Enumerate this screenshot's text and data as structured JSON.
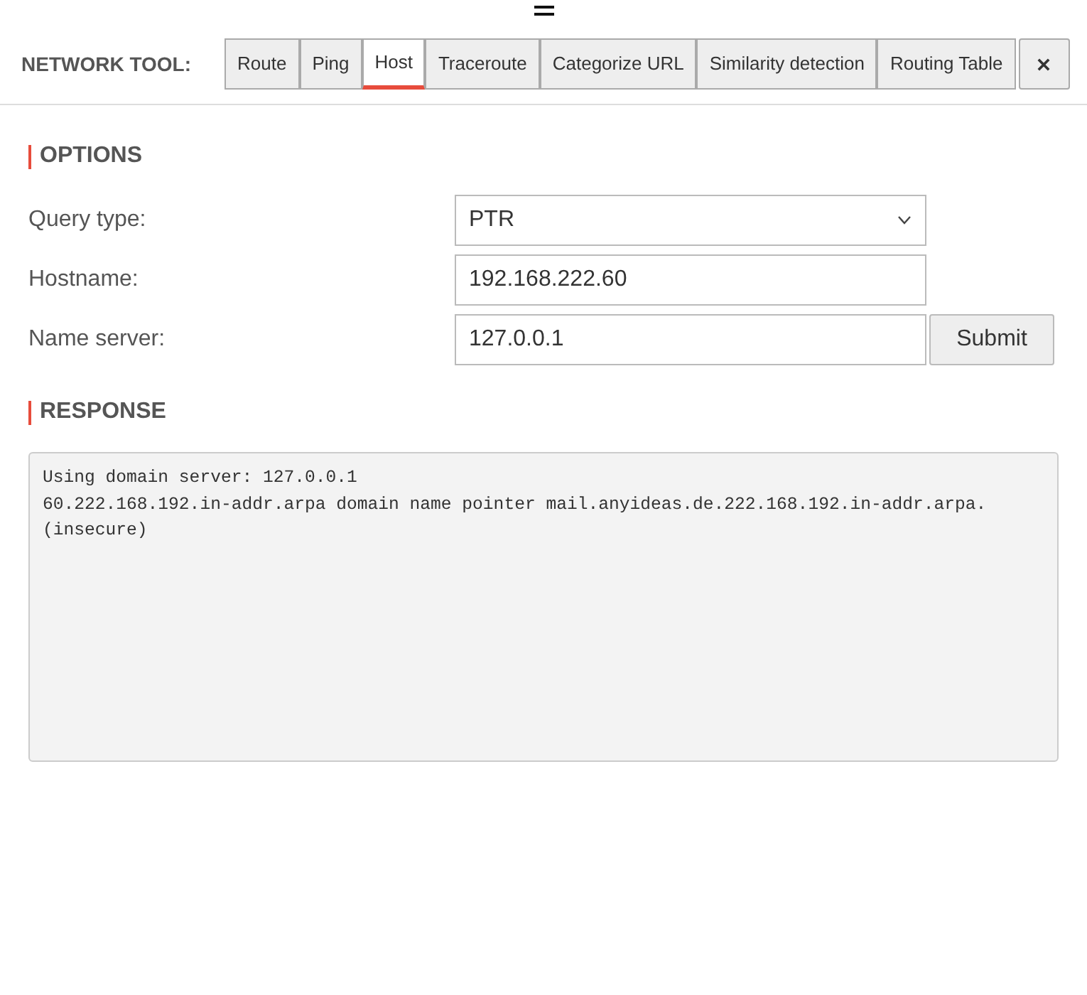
{
  "header": {
    "title": "NETWORK TOOL:",
    "tabs": [
      {
        "label": "Route",
        "selected": false
      },
      {
        "label": "Ping",
        "selected": false
      },
      {
        "label": "Host",
        "selected": true
      },
      {
        "label": "Traceroute",
        "selected": false
      },
      {
        "label": "Categorize URL",
        "selected": false
      },
      {
        "label": "Similarity detection",
        "selected": false
      },
      {
        "label": "Routing Table",
        "selected": false
      }
    ]
  },
  "options": {
    "heading": "OPTIONS",
    "fields": [
      {
        "kind": "select",
        "label": "Query type:",
        "value": "PTR"
      },
      {
        "kind": "text",
        "label": "Hostname:",
        "value": "192.168.222.60"
      },
      {
        "kind": "text",
        "label": "Name server:",
        "value": "127.0.0.1",
        "button": "Submit"
      }
    ]
  },
  "response": {
    "heading": "RESPONSE",
    "lines": [
      "Using domain server: 127.0.0.1",
      "60.222.168.192.in-addr.arpa domain name pointer mail.anyideas.de.222.168.192.in-addr.arpa.",
      "(insecure)"
    ]
  }
}
